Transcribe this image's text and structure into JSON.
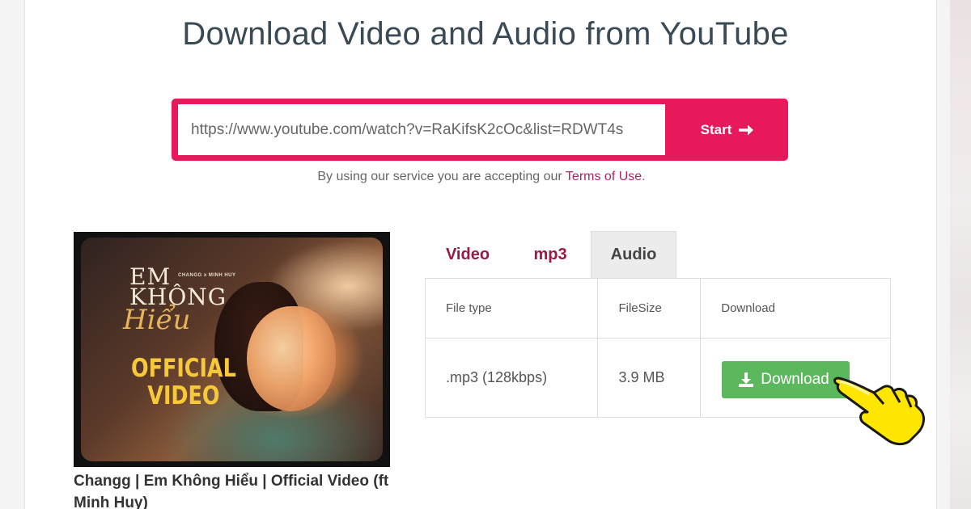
{
  "page": {
    "title": "Download Video and Audio from YouTube"
  },
  "search": {
    "value": "https://www.youtube.com/watch?v=RaKifsK2cOc&list=RDWT4s",
    "start_label": "Start"
  },
  "terms": {
    "prefix": "By using our service you are accepting our ",
    "link": "Terms of Use",
    "suffix": "."
  },
  "video": {
    "caption": "Changg | Em Không Hiểu | Official Video (ft Minh Huy)",
    "thumbnail_text": {
      "artists": "CHANGG x MINH HUY",
      "title": "EM\nKHÔNG",
      "script": "Hiểu",
      "badge": "OFFICIAL\nVIDEO"
    }
  },
  "tabs": [
    {
      "label": "Video",
      "active": false
    },
    {
      "label": "mp3",
      "active": false
    },
    {
      "label": "Audio",
      "active": true
    }
  ],
  "table": {
    "headers": [
      "File type",
      "FileSize",
      "Download"
    ],
    "rows": [
      {
        "file_type": ".mp3 (128kbps)",
        "file_size": "3.9 MB",
        "download_label": "Download"
      }
    ]
  },
  "colors": {
    "accent": "#e7195a",
    "tab_text": "#9b1747",
    "download_button": "#5cb85c",
    "pointer_hand": "#ffe600"
  },
  "icons": {
    "start": "arrow-right-icon",
    "download": "download-icon",
    "cursor": "pointing-hand-icon"
  }
}
